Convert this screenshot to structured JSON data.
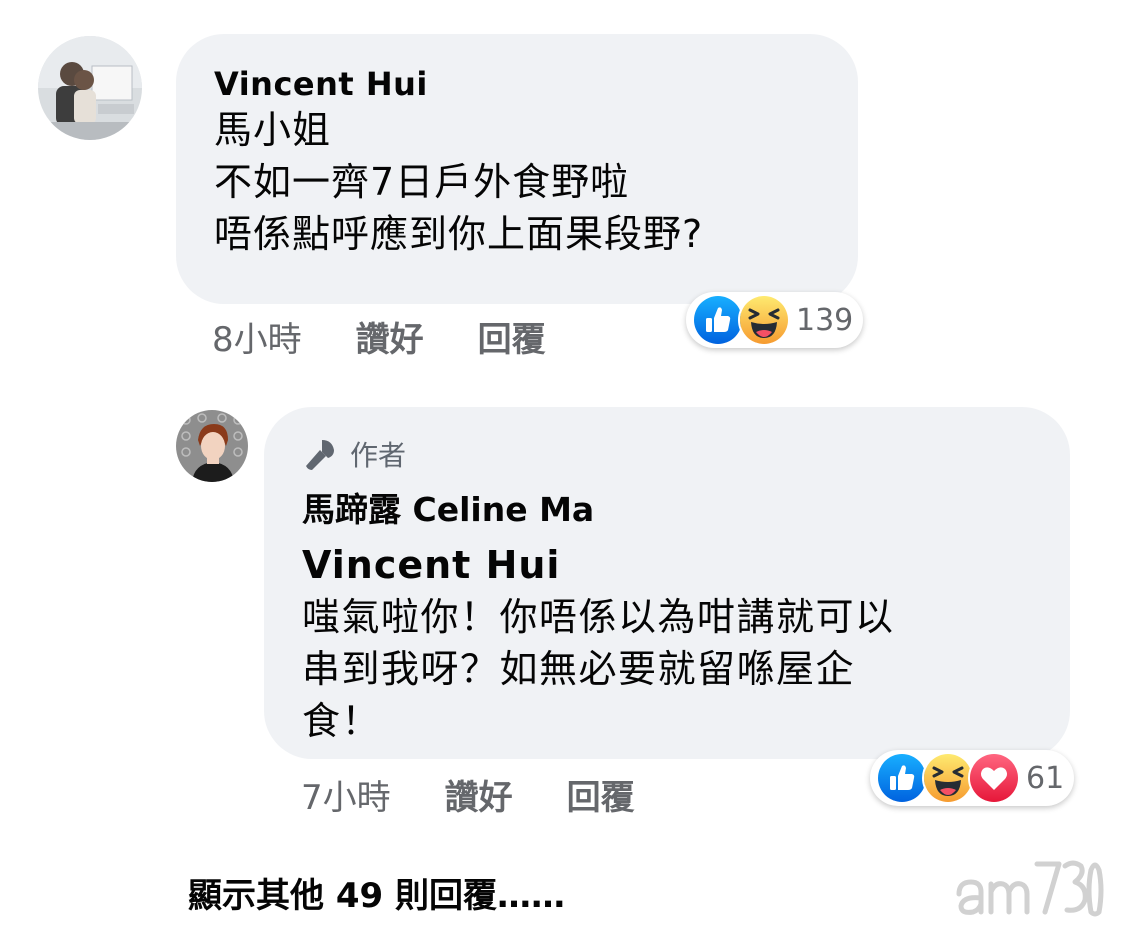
{
  "comment": {
    "author": "Vincent Hui",
    "lines": [
      "馬小姐",
      "不如一齊7日戶外食野啦",
      "唔係點呼應到你上面果段野?"
    ],
    "timestamp": "8小時",
    "like_label": "讚好",
    "reply_label": "回覆",
    "reactions": [
      "like-icon",
      "haha-icon"
    ],
    "reaction_count": "139"
  },
  "reply": {
    "author_tag": "作者",
    "author": "馬蹄露 Celine Ma",
    "mention": "Vincent Hui",
    "lines": [
      "嗤氣啦你！你唔係以為咁講就可以",
      "串到我呀？如無必要就留喺屋企",
      "食！"
    ],
    "timestamp": "7小時",
    "like_label": "讚好",
    "reply_label": "回覆",
    "reactions": [
      "like-icon",
      "haha-icon",
      "love-icon"
    ],
    "reaction_count": "61"
  },
  "more_replies": "顯示其他 49 則回覆……",
  "watermark": "am730",
  "colors": {
    "bubble": "#f0f2f5",
    "meta_text": "#65676b",
    "like_blue": "#1877f2",
    "haha_yellow": "#f7b928",
    "love_red": "#f33e58"
  }
}
